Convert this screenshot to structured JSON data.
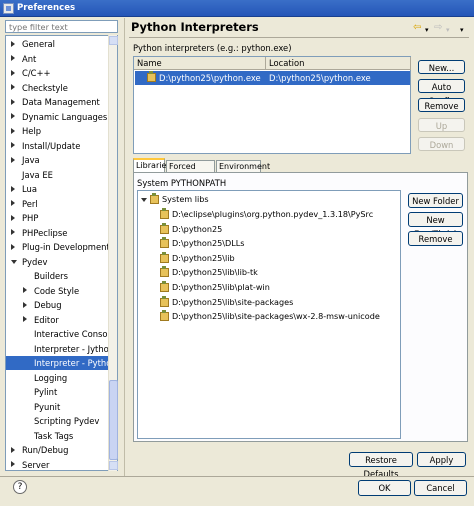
{
  "window": {
    "title": "Preferences"
  },
  "filter": {
    "placeholder": "type filter text"
  },
  "tree": {
    "items": [
      {
        "label": "General",
        "level": 0,
        "twisty": "collapsed"
      },
      {
        "label": "Ant",
        "level": 0,
        "twisty": "collapsed"
      },
      {
        "label": "C/C++",
        "level": 0,
        "twisty": "collapsed"
      },
      {
        "label": "Checkstyle",
        "level": 0,
        "twisty": "collapsed"
      },
      {
        "label": "Data Management",
        "level": 0,
        "twisty": "collapsed"
      },
      {
        "label": "Dynamic Languages",
        "level": 0,
        "twisty": "collapsed"
      },
      {
        "label": "Help",
        "level": 0,
        "twisty": "collapsed"
      },
      {
        "label": "Install/Update",
        "level": 0,
        "twisty": "collapsed"
      },
      {
        "label": "Java",
        "level": 0,
        "twisty": "collapsed"
      },
      {
        "label": "Java EE",
        "level": 0,
        "twisty": "none"
      },
      {
        "label": "Lua",
        "level": 0,
        "twisty": "collapsed"
      },
      {
        "label": "Perl",
        "level": 0,
        "twisty": "collapsed"
      },
      {
        "label": "PHP",
        "level": 0,
        "twisty": "collapsed"
      },
      {
        "label": "PHPeclipse",
        "level": 0,
        "twisty": "collapsed"
      },
      {
        "label": "Plug-in Development",
        "level": 0,
        "twisty": "collapsed"
      },
      {
        "label": "Pydev",
        "level": 0,
        "twisty": "expanded"
      },
      {
        "label": "Builders",
        "level": 1,
        "twisty": "none"
      },
      {
        "label": "Code Style",
        "level": 1,
        "twisty": "collapsed"
      },
      {
        "label": "Debug",
        "level": 1,
        "twisty": "collapsed"
      },
      {
        "label": "Editor",
        "level": 1,
        "twisty": "collapsed"
      },
      {
        "label": "Interactive Console",
        "level": 1,
        "twisty": "none"
      },
      {
        "label": "Interpreter - Jython",
        "level": 1,
        "twisty": "none"
      },
      {
        "label": "Interpreter - Python",
        "level": 1,
        "twisty": "none",
        "selected": true
      },
      {
        "label": "Logging",
        "level": 1,
        "twisty": "none"
      },
      {
        "label": "Pylint",
        "level": 1,
        "twisty": "none"
      },
      {
        "label": "Pyunit",
        "level": 1,
        "twisty": "none"
      },
      {
        "label": "Scripting Pydev",
        "level": 1,
        "twisty": "none"
      },
      {
        "label": "Task Tags",
        "level": 1,
        "twisty": "none"
      },
      {
        "label": "Run/Debug",
        "level": 0,
        "twisty": "collapsed"
      },
      {
        "label": "Server",
        "level": 0,
        "twisty": "collapsed"
      }
    ]
  },
  "page": {
    "title": "Python Interpreters",
    "interpreters_label": "Python interpreters (e.g.: python.exe)",
    "table": {
      "columns": [
        "Name",
        "Location"
      ],
      "rows": [
        {
          "name": "D:\\python25\\python.exe",
          "location": "D:\\python25\\python.exe"
        }
      ]
    },
    "buttons": {
      "new": "New...",
      "auto_config": "Auto Config",
      "remove": "Remove",
      "up": "Up",
      "down": "Down"
    },
    "tabs": [
      "Libraries",
      "Forced Builtins",
      "Environment"
    ],
    "pythonpath_label": "System PYTHONPATH",
    "libs_root": "System libs",
    "libs": [
      "D:\\eclipse\\plugins\\org.python.pydev_1.3.18\\PySrc",
      "D:\\python25",
      "D:\\python25\\DLLs",
      "D:\\python25\\lib",
      "D:\\python25\\lib\\lib-tk",
      "D:\\python25\\lib\\plat-win",
      "D:\\python25\\lib\\site-packages",
      "D:\\python25\\lib\\site-packages\\wx-2.8-msw-unicode"
    ],
    "lib_buttons": {
      "new_folder": "New Folder",
      "new_egg": "New Egg/Zip(s)",
      "remove": "Remove"
    },
    "restore_defaults": "Restore Defaults",
    "apply": "Apply"
  },
  "dialog": {
    "ok": "OK",
    "cancel": "Cancel",
    "help": "?"
  },
  "nav": {
    "back": "⇦",
    "back_menu": "▾",
    "forward": "⇨",
    "forward_menu": "▾",
    "view_menu": "▾"
  },
  "colors": {
    "selection": "#316ac5",
    "title_bar": "#2455b8",
    "dialog_bg": "#ece9d8"
  }
}
